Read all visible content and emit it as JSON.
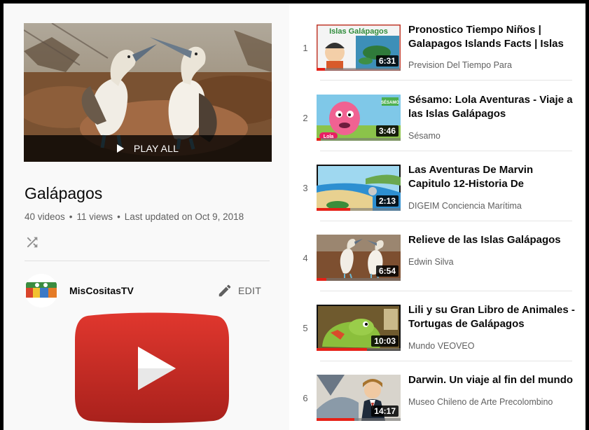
{
  "playlist": {
    "title": "Galápagos",
    "play_all_label": "PLAY ALL",
    "video_count": "40 videos",
    "views": "11 views",
    "last_updated": "Last updated on Oct 9, 2018",
    "separator": "•",
    "shuffle_icon": "shuffle-icon"
  },
  "owner": {
    "name": "MisCositasTV",
    "edit_label": "EDIT",
    "edit_icon": "pencil-icon"
  },
  "colors": {
    "youtube_red": "#c4302b",
    "progress_red": "#e62117",
    "secondary_text": "#606060"
  },
  "videos": [
    {
      "index": "1",
      "title": "Pronostico Tiempo Niños | Galapagos Islands Facts | Islas",
      "channel": "Prevision Del Tiempo Para",
      "duration": "6:31",
      "thumb_text": "Islas Galápagos",
      "watched_fraction": 0.1
    },
    {
      "index": "2",
      "title": "Sésamo: Lola Aventuras - Viaje a las Islas Galápagos",
      "channel": "Sésamo",
      "duration": "3:46",
      "thumb_text": "SÉSAMO",
      "thumb_text_2": "Lola",
      "watched_fraction": 0.05
    },
    {
      "index": "3",
      "title": "Las Aventuras De Marvin Capitulo 12-Historia De",
      "channel": "DIGEIM Conciencia Marítima",
      "duration": "2:13",
      "watched_fraction": 0.4
    },
    {
      "index": "4",
      "title": "Relieve de las Islas Galápagos",
      "channel": "Edwin Silva",
      "duration": "6:54",
      "watched_fraction": 0.12
    },
    {
      "index": "5",
      "title": "Lili y su Gran Libro de Animales - Tortugas de Galápagos",
      "channel": "Mundo VEOVEO",
      "duration": "10:03",
      "watched_fraction": 0.6
    },
    {
      "index": "6",
      "title": "Darwin. Un viaje al fin del mundo",
      "channel": "Museo Chileno de Arte Precolombino",
      "duration": "14:17",
      "watched_fraction": 0.45
    }
  ]
}
